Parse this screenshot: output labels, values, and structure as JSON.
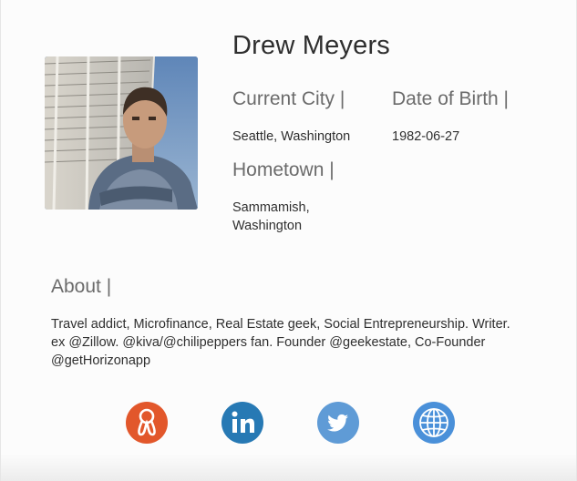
{
  "profile": {
    "name": "Drew Meyers",
    "current_city_label": "Current City |",
    "current_city": "Seattle, Washington",
    "dob_label": "Date of Birth |",
    "dob": "1982-06-27",
    "hometown_label": "Hometown |",
    "hometown_line1": "Sammamish,",
    "hometown_line2": "Washington"
  },
  "about": {
    "label": "About |",
    "line1": "Travel addict, Microfinance, Real Estate geek, Social Entrepreneurship. Writer.",
    "line2": "ex @Zillow. @kiva/@chilipeppers fan. Founder @geekestate, Co-Founder",
    "line3": "@getHorizonapp"
  },
  "social_links": [
    {
      "icon": "couchsurfing-icon",
      "color": "#e2572b"
    },
    {
      "icon": "linkedin-icon",
      "color": "#2779b4"
    },
    {
      "icon": "twitter-icon",
      "color": "#5f9bd6"
    },
    {
      "icon": "globe-icon",
      "color": "#4a90d9"
    }
  ]
}
